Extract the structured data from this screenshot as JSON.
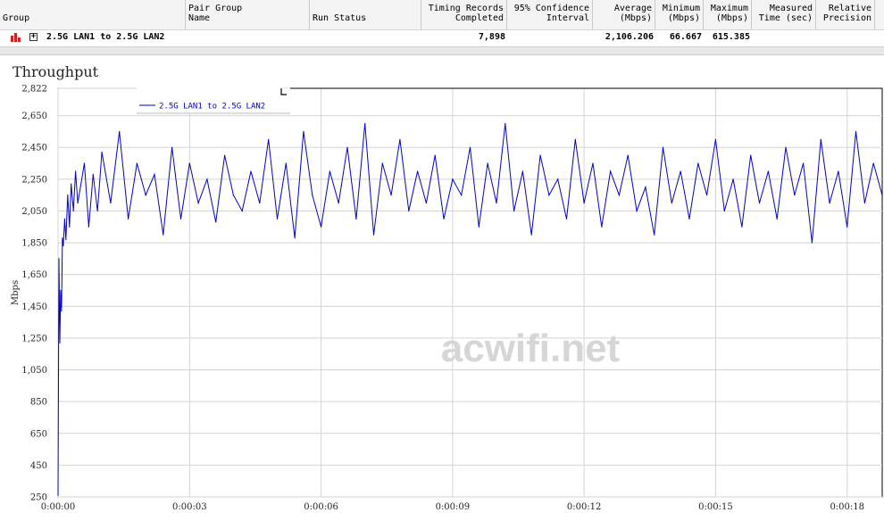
{
  "table": {
    "headers": [
      {
        "key": "group",
        "label": "Group"
      },
      {
        "key": "pair_group_name",
        "label": "Pair Group\nName"
      },
      {
        "key": "run_status",
        "label": "Run Status"
      },
      {
        "key": "timing_records",
        "label": "Timing Records\nCompleted"
      },
      {
        "key": "confidence",
        "label": "95% Confidence\nInterval"
      },
      {
        "key": "average",
        "label": "Average\n(Mbps)"
      },
      {
        "key": "minimum",
        "label": "Minimum\n(Mbps)"
      },
      {
        "key": "maximum",
        "label": "Maximum\n(Mbps)"
      },
      {
        "key": "measured_time",
        "label": "Measured\nTime (sec)"
      },
      {
        "key": "relative_precision",
        "label": "Relative\nPrecision"
      }
    ],
    "row": {
      "group": "2.5G LAN1 to 2.5G LAN2",
      "timing_records": "7,898",
      "average": "2,106.206",
      "minimum": "66.667",
      "maximum": "615.385"
    }
  },
  "chart_data": {
    "type": "line",
    "title": "Throughput",
    "ylabel": "Mbps",
    "xlabel": "",
    "ylim": [
      250,
      2822
    ],
    "yticks": [
      2822,
      2650,
      2450,
      2250,
      2050,
      1850,
      1650,
      1450,
      1250,
      1050,
      850,
      650,
      450,
      250
    ],
    "ytick_labels": [
      "2,822",
      "2,650",
      "2,450",
      "2,250",
      "2,050",
      "1,850",
      "1,650",
      "1,450",
      "1,250",
      "1,050",
      "850",
      "650",
      "450",
      "250"
    ],
    "xlim_seconds": [
      0,
      18.8
    ],
    "xticks_seconds": [
      0,
      3,
      6,
      9,
      12,
      15,
      18
    ],
    "xtick_labels": [
      "0:00:00",
      "0:00:03",
      "0:00:06",
      "0:00:09",
      "0:00:12",
      "0:00:15",
      "0:00:18"
    ],
    "grid": true,
    "legend_position": "top-left",
    "series": [
      {
        "name": "2.5G LAN1 to 2.5G LAN2",
        "color": "#0000cc",
        "x": [
          0.0,
          0.02,
          0.04,
          0.06,
          0.08,
          0.1,
          0.12,
          0.15,
          0.18,
          0.22,
          0.26,
          0.3,
          0.35,
          0.4,
          0.45,
          0.5,
          0.6,
          0.7,
          0.8,
          0.9,
          1.0,
          1.2,
          1.4,
          1.6,
          1.8,
          2.0,
          2.2,
          2.4,
          2.6,
          2.8,
          3.0,
          3.2,
          3.4,
          3.6,
          3.8,
          4.0,
          4.2,
          4.4,
          4.6,
          4.8,
          5.0,
          5.2,
          5.4,
          5.6,
          5.8,
          6.0,
          6.2,
          6.4,
          6.6,
          6.8,
          7.0,
          7.2,
          7.4,
          7.6,
          7.8,
          8.0,
          8.2,
          8.4,
          8.6,
          8.8,
          9.0,
          9.2,
          9.4,
          9.6,
          9.8,
          10.0,
          10.2,
          10.4,
          10.6,
          10.8,
          11.0,
          11.2,
          11.4,
          11.6,
          11.8,
          12.0,
          12.2,
          12.4,
          12.6,
          12.8,
          13.0,
          13.2,
          13.4,
          13.6,
          13.8,
          14.0,
          14.2,
          14.4,
          14.6,
          14.8,
          15.0,
          15.2,
          15.4,
          15.6,
          15.8,
          16.0,
          16.2,
          16.4,
          16.6,
          16.8,
          17.0,
          17.2,
          17.4,
          17.6,
          17.8,
          18.0,
          18.2,
          18.4,
          18.6,
          18.8
        ],
        "values": [
          260,
          1750,
          1220,
          1550,
          1420,
          1880,
          1830,
          2000,
          1870,
          2150,
          1950,
          2220,
          2050,
          2300,
          2100,
          2180,
          2350,
          1950,
          2280,
          2050,
          2420,
          2100,
          2550,
          2000,
          2350,
          2150,
          2280,
          1900,
          2450,
          2000,
          2350,
          2100,
          2250,
          1980,
          2400,
          2150,
          2050,
          2300,
          2100,
          2500,
          2000,
          2350,
          1880,
          2550,
          2150,
          1950,
          2300,
          2100,
          2450,
          2000,
          2600,
          1900,
          2350,
          2150,
          2500,
          2050,
          2300,
          2100,
          2400,
          2000,
          2250,
          2150,
          2450,
          1950,
          2350,
          2100,
          2600,
          2050,
          2300,
          1900,
          2400,
          2150,
          2250,
          2000,
          2500,
          2100,
          2350,
          1950,
          2300,
          2150,
          2400,
          2050,
          2200,
          1900,
          2450,
          2100,
          2300,
          2000,
          2350,
          2150,
          2500,
          2050,
          2250,
          1950,
          2400,
          2100,
          2300,
          2000,
          2450,
          2150,
          2350,
          1850,
          2500,
          2100,
          2300,
          1950,
          2550,
          2100,
          2350,
          2150
        ]
      }
    ]
  },
  "watermark": "acwifi.net"
}
